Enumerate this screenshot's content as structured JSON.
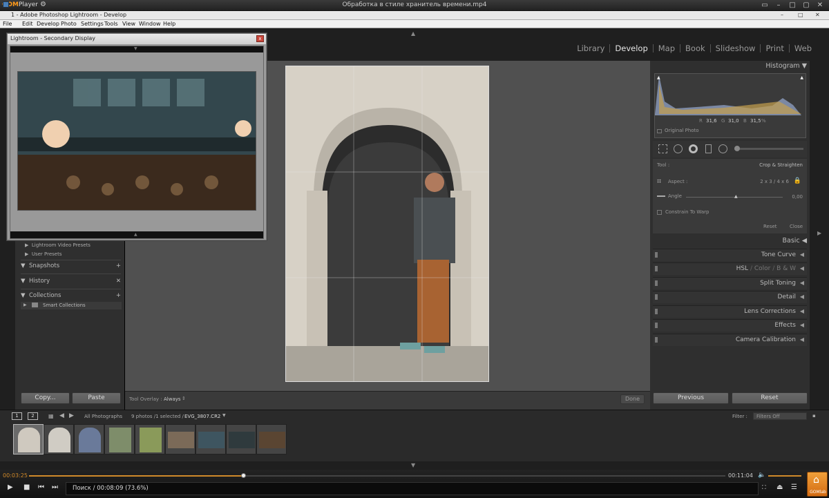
{
  "player": {
    "logo": "GOM",
    "logo_suffix": "Player",
    "title": "Обработка в стиле хранитель времени.mp4",
    "time_current": "00:03:25",
    "time_total": "00:11:04",
    "progress": 0.309,
    "status": "Поиск / 00:08:09 (73.6%)",
    "brand_button": "GOMlab"
  },
  "lightroom": {
    "window_title": "1 - Adobe Photoshop Lightroom - Develop",
    "menu": [
      "File",
      "Edit",
      "Develop",
      "Photo",
      "Settings",
      "Tools",
      "View",
      "Window",
      "Help"
    ],
    "modules": [
      "Library",
      "Develop",
      "Map",
      "Book",
      "Slideshow",
      "Print",
      "Web"
    ],
    "active_module": "Develop",
    "secondary_window_title": "Lightroom - Secondary Display"
  },
  "left_panel": {
    "presets": [
      "Lightroom Video Presets",
      "User Presets"
    ],
    "snapshots": "Snapshots",
    "history": "History",
    "collections": "Collections",
    "smart_collections": "Smart Collections",
    "copy": "Copy...",
    "paste": "Paste"
  },
  "right_panel": {
    "histogram": "Histogram",
    "original_photo": "Original Photo",
    "rgb_r": "R",
    "rgb_r_val": "31,6",
    "rgb_g": "G",
    "rgb_g_val": "31,0",
    "rgb_b": "B",
    "rgb_b_val": "31,5",
    "percent": "%",
    "tool_label": "Tool :",
    "tool_value": "Crop & Straighten",
    "aspect_label": "Aspect :",
    "aspect_value": "2 x 3  /  4 x 6",
    "angle_label": "Angle",
    "angle_value": "0,00",
    "constrain": "Constrain To Warp",
    "reset": "Reset",
    "close": "Close",
    "sections": [
      "Basic",
      "Tone Curve",
      "HSL",
      "Color",
      "B & W",
      "Split Toning",
      "Detail",
      "Lens Corrections",
      "Effects",
      "Camera Calibration"
    ],
    "previous": "Previous",
    "reset_button": "Reset"
  },
  "toolbar": {
    "overlay_label": "Tool Overlay :",
    "overlay_value": "Always",
    "done": "Done"
  },
  "filmstrip": {
    "screen1": "1",
    "screen2": "2",
    "source": "All Photographs",
    "count": "9 photos /1 selected /",
    "filename": "EVG_3807.CR2",
    "filter_label": "Filter :",
    "filter_value": "Filters Off"
  },
  "colors": {
    "accent": "#d18a2a",
    "panel": "#2f2f2f",
    "center": "#505050"
  }
}
